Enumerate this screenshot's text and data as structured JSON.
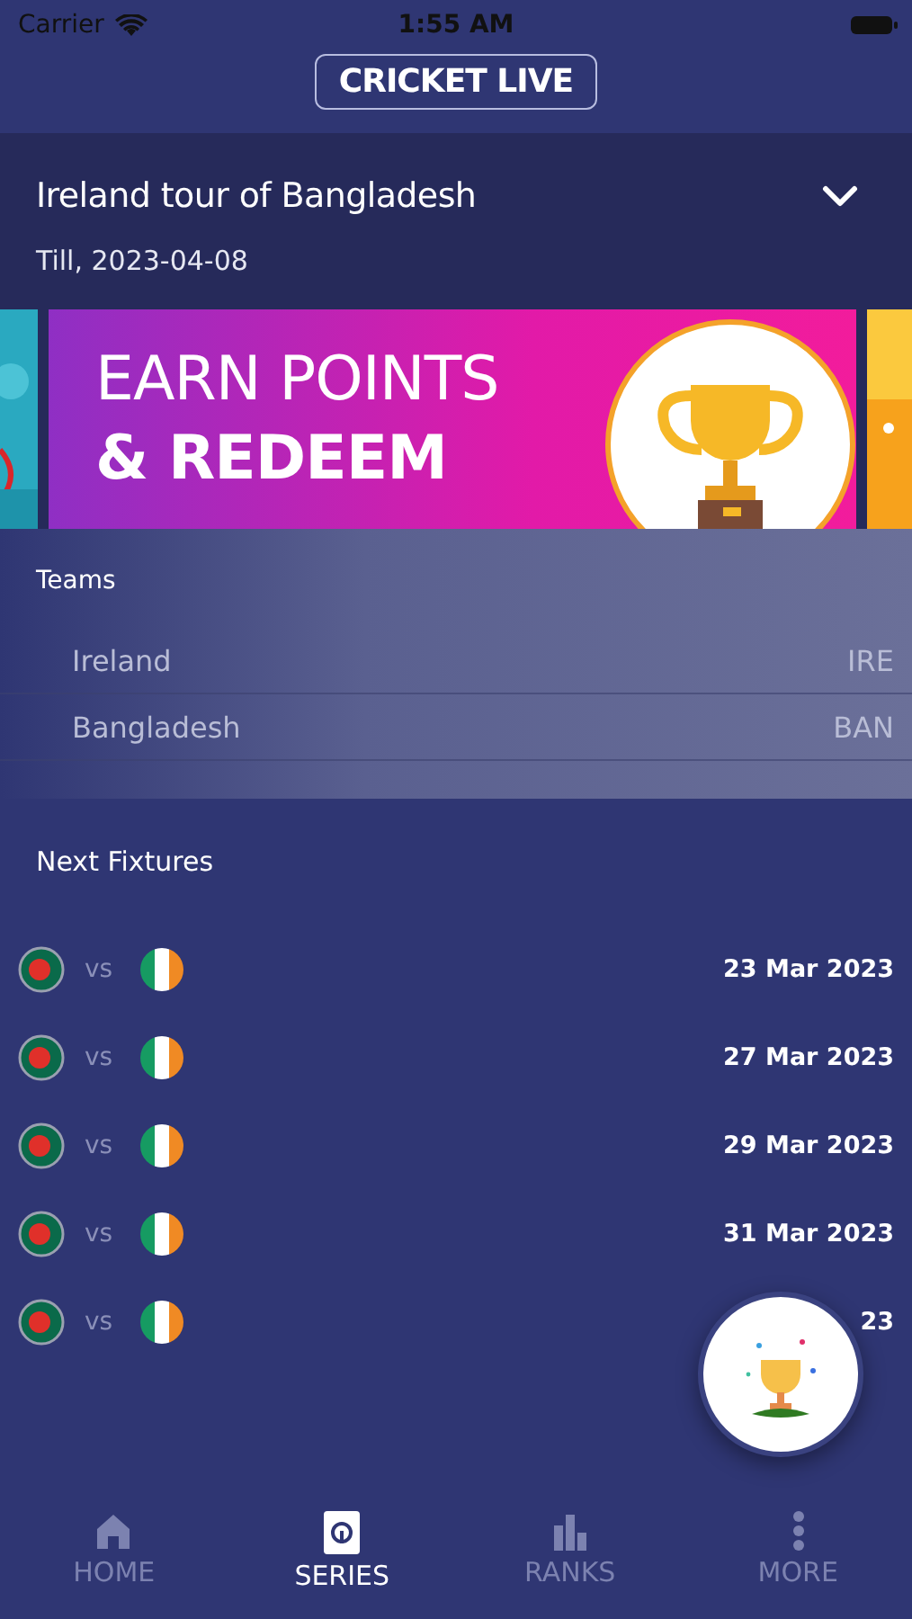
{
  "status_bar": {
    "carrier": "Carrier",
    "time": "1:55 AM"
  },
  "header": {
    "title": "CRICKET LIVE"
  },
  "series": {
    "title": "Ireland tour of Bangladesh",
    "subtitle": "Till, 2023-04-08",
    "expanded": false
  },
  "banner": {
    "lines": [
      "EARN POINTS",
      "& REDEEM"
    ]
  },
  "teams": {
    "heading": "Teams",
    "rows": [
      {
        "name": "Ireland",
        "code": "IRE"
      },
      {
        "name": "Bangladesh",
        "code": "BAN"
      }
    ]
  },
  "fixtures": {
    "heading": "Next Fixtures",
    "rows": [
      {
        "vs": "vs",
        "date": "23 Mar 2023"
      },
      {
        "vs": "vs",
        "date": "27 Mar 2023"
      },
      {
        "vs": "vs",
        "date": "29 Mar 2023"
      },
      {
        "vs": "vs",
        "date": "31 Mar 2023"
      },
      {
        "vs": "vs",
        "date": "23"
      }
    ]
  },
  "tabs": [
    {
      "label": "HOME",
      "kind": "home",
      "selected": false
    },
    {
      "label": "SERIES",
      "kind": "series",
      "selected": true
    },
    {
      "label": "RANKS",
      "kind": "ranks",
      "selected": false
    },
    {
      "label": "MORE",
      "kind": "more",
      "selected": false
    }
  ]
}
